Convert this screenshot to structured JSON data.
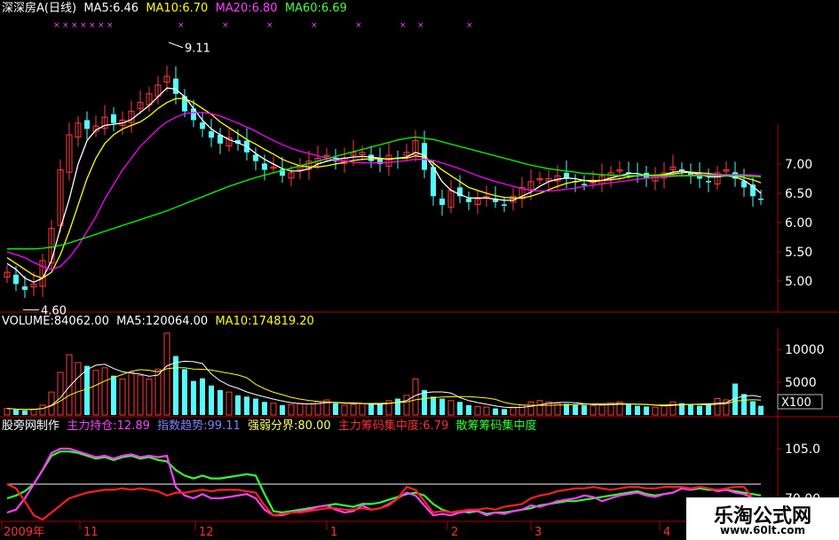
{
  "header_price": {
    "stock_name": "深深房A",
    "period": "(日线)",
    "ma5": "MA5:6.46",
    "ma10": "MA10:6.70",
    "ma20": "MA20:6.80",
    "ma60": "MA60:6.69"
  },
  "header_volume": {
    "volume": "VOLUME:84062.00",
    "ma5": "MA5:120064.00",
    "ma10": "MA10:174819.20"
  },
  "header_indicator": {
    "source": "股旁网制作",
    "main_holding": "主力持仓:12.89",
    "index_trend": "指数趋势:99.11",
    "strong_weak": "强弱分界:80.00",
    "main_chip": "主力筹码集中度:6.79",
    "retail_chip": "散筹筹码集中度"
  },
  "colors": {
    "up": "#ff3b3b",
    "down": "#54fcfc",
    "ma5": "#ffffff",
    "ma10": "#ffff00",
    "ma20": "#ff00ff",
    "ma60": "#00ff00",
    "axis": "#b00000",
    "indicator_red": "#ff2020",
    "indicator_pink": "#ff40ff",
    "indicator_green": "#30ff30",
    "indicator_line": "#c8c8c8"
  },
  "chart_data": [
    {
      "type": "line",
      "panel": "price",
      "note": "candlestick panel",
      "ylim": [
        4.5,
        9.5
      ],
      "yticks": [
        "7.00",
        "6.50",
        "6.00",
        "5.50",
        "5.00"
      ],
      "annotations": [
        "9.11",
        "4.60"
      ],
      "x": [
        0,
        10,
        20,
        30,
        40,
        50,
        60,
        70,
        80,
        90,
        100,
        110,
        120,
        130,
        140,
        150,
        160,
        170,
        180,
        190,
        200,
        210,
        220,
        230,
        240,
        250,
        260,
        270,
        280,
        290,
        300,
        310,
        320,
        330,
        340,
        350,
        360,
        370,
        380,
        390,
        400,
        410,
        420,
        430,
        440,
        450,
        460,
        470,
        480,
        490,
        500,
        510,
        520,
        530,
        540,
        550,
        560,
        570,
        580,
        590,
        600,
        610,
        620,
        630,
        640,
        650,
        660,
        670,
        680,
        690,
        700,
        710,
        720,
        730,
        740,
        750,
        760,
        770,
        780,
        790,
        800,
        810,
        820,
        830,
        840,
        849
      ],
      "close": [
        5.15,
        4.95,
        4.85,
        4.95,
        5.35,
        5.9,
        6.9,
        7.5,
        7.7,
        7.6,
        7.65,
        7.8,
        7.7,
        7.75,
        7.9,
        8.05,
        8.2,
        8.35,
        8.5,
        8.2,
        7.9,
        7.75,
        7.6,
        7.45,
        7.35,
        7.45,
        7.35,
        7.2,
        7.05,
        6.9,
        6.95,
        6.8,
        6.85,
        6.95,
        7.05,
        7.1,
        7.15,
        7.05,
        7.1,
        7.2,
        7.2,
        7.05,
        7.0,
        7.15,
        7.1,
        7.2,
        7.4,
        6.9,
        6.45,
        6.3,
        6.55,
        6.45,
        6.35,
        6.4,
        6.45,
        6.35,
        6.3,
        6.45,
        6.6,
        6.7,
        6.75,
        6.75,
        6.8,
        6.75,
        6.7,
        6.65,
        6.7,
        6.8,
        6.85,
        6.9,
        6.85,
        6.8,
        6.75,
        6.8,
        6.85,
        6.95,
        6.9,
        6.8,
        6.75,
        6.7,
        6.85,
        6.9,
        6.75,
        6.6,
        6.45,
        6.4
      ],
      "series": [
        {
          "name": "MA5",
          "values": [
            5.3,
            5.2,
            5.05,
            4.98,
            5.05,
            5.35,
            5.9,
            6.4,
            7.0,
            7.4,
            7.58,
            7.66,
            7.68,
            7.7,
            7.76,
            7.88,
            8.0,
            8.15,
            8.3,
            8.28,
            8.15,
            7.95,
            7.75,
            7.6,
            7.5,
            7.42,
            7.36,
            7.3,
            7.18,
            7.08,
            7.0,
            6.92,
            6.88,
            6.88,
            6.92,
            7.0,
            7.05,
            7.08,
            7.1,
            7.12,
            7.13,
            7.12,
            7.1,
            7.08,
            7.1,
            7.12,
            7.2,
            7.15,
            6.95,
            6.7,
            6.55,
            6.48,
            6.42,
            6.42,
            6.42,
            6.4,
            6.38,
            6.38,
            6.45,
            6.52,
            6.62,
            6.7,
            6.74,
            6.76,
            6.75,
            6.72,
            6.7,
            6.72,
            6.76,
            6.8,
            6.84,
            6.84,
            6.8,
            6.8,
            6.82,
            6.86,
            6.88,
            6.86,
            6.82,
            6.78,
            6.78,
            6.8,
            6.78,
            6.72,
            6.62,
            6.5
          ]
        },
        {
          "name": "MA10",
          "values": [
            5.4,
            5.3,
            5.2,
            5.1,
            5.05,
            5.15,
            5.45,
            5.85,
            6.3,
            6.75,
            7.1,
            7.35,
            7.5,
            7.6,
            7.66,
            7.72,
            7.82,
            7.95,
            8.05,
            8.12,
            8.12,
            8.05,
            7.95,
            7.85,
            7.72,
            7.62,
            7.52,
            7.42,
            7.34,
            7.25,
            7.17,
            7.08,
            7.02,
            6.97,
            6.95,
            6.95,
            6.97,
            7.0,
            7.03,
            7.06,
            7.08,
            7.09,
            7.09,
            7.09,
            7.1,
            7.1,
            7.14,
            7.12,
            7.02,
            6.9,
            6.8,
            6.7,
            6.6,
            6.55,
            6.5,
            6.46,
            6.43,
            6.42,
            6.42,
            6.45,
            6.5,
            6.56,
            6.62,
            6.67,
            6.7,
            6.72,
            6.72,
            6.72,
            6.73,
            6.75,
            6.78,
            6.8,
            6.81,
            6.81,
            6.82,
            6.83,
            6.85,
            6.86,
            6.85,
            6.84,
            6.82,
            6.81,
            6.8,
            6.77,
            6.73,
            6.68
          ]
        },
        {
          "name": "MA20",
          "values": [
            5.5,
            5.45,
            5.4,
            5.32,
            5.25,
            5.2,
            5.25,
            5.4,
            5.6,
            5.85,
            6.1,
            6.4,
            6.65,
            6.9,
            7.1,
            7.3,
            7.45,
            7.6,
            7.72,
            7.8,
            7.86,
            7.88,
            7.88,
            7.86,
            7.82,
            7.76,
            7.7,
            7.63,
            7.56,
            7.48,
            7.4,
            7.33,
            7.27,
            7.22,
            7.18,
            7.14,
            7.1,
            7.07,
            7.05,
            7.03,
            7.02,
            7.02,
            7.02,
            7.03,
            7.04,
            7.06,
            7.08,
            7.08,
            7.06,
            7.02,
            6.97,
            6.92,
            6.86,
            6.8,
            6.75,
            6.7,
            6.66,
            6.62,
            6.58,
            6.55,
            6.54,
            6.54,
            6.55,
            6.57,
            6.59,
            6.62,
            6.64,
            6.66,
            6.68,
            6.7,
            6.72,
            6.74,
            6.76,
            6.77,
            6.78,
            6.79,
            6.8,
            6.81,
            6.82,
            6.82,
            6.82,
            6.82,
            6.82,
            6.82,
            6.81,
            6.8
          ]
        },
        {
          "name": "MA60",
          "values": [
            5.55,
            5.55,
            5.55,
            5.55,
            5.56,
            5.58,
            5.61,
            5.65,
            5.7,
            5.75,
            5.8,
            5.85,
            5.9,
            5.95,
            6.0,
            6.05,
            6.1,
            6.15,
            6.2,
            6.26,
            6.32,
            6.38,
            6.44,
            6.5,
            6.56,
            6.62,
            6.67,
            6.72,
            6.77,
            6.81,
            6.85,
            6.89,
            6.93,
            6.97,
            7.01,
            7.05,
            7.09,
            7.13,
            7.17,
            7.21,
            7.25,
            7.29,
            7.33,
            7.37,
            7.41,
            7.44,
            7.46,
            7.44,
            7.42,
            7.38,
            7.34,
            7.3,
            7.26,
            7.22,
            7.18,
            7.14,
            7.1,
            7.06,
            7.02,
            6.98,
            6.95,
            6.92,
            6.9,
            6.88,
            6.86,
            6.84,
            6.83,
            6.82,
            6.81,
            6.8,
            6.8,
            6.8,
            6.8,
            6.8,
            6.8,
            6.8,
            6.8,
            6.8,
            6.8,
            6.8,
            6.8,
            6.8,
            6.8,
            6.8,
            6.79,
            6.78
          ]
        }
      ]
    },
    {
      "type": "bar",
      "panel": "volume",
      "ylim": [
        0,
        13000
      ],
      "yticks": [
        "10000",
        "5000"
      ],
      "unit_label": "X100",
      "values": [
        1000,
        800,
        700,
        900,
        1500,
        3500,
        6500,
        9200,
        8000,
        7500,
        6800,
        7200,
        6000,
        5500,
        6500,
        6000,
        5500,
        7000,
        12500,
        9000,
        7000,
        5200,
        5600,
        4500,
        3800,
        3500,
        3000,
        2800,
        2500,
        2000,
        1800,
        1500,
        1600,
        1800,
        1700,
        2000,
        2300,
        1800,
        1500,
        1600,
        1700,
        1600,
        1700,
        2200,
        2500,
        3000,
        5500,
        3800,
        2800,
        2500,
        2200,
        2000,
        1500,
        1300,
        1200,
        1000,
        900,
        1200,
        1500,
        2000,
        2200,
        2000,
        1800,
        1700,
        1600,
        1500,
        1400,
        1500,
        1800,
        2000,
        1600,
        1400,
        1300,
        1200,
        1500,
        2000,
        1800,
        1600,
        1400,
        1700,
        2500,
        2300,
        4800,
        3200,
        2100,
        1400
      ]
    },
    {
      "type": "line",
      "panel": "indicator",
      "ylim": [
        55,
        115
      ],
      "yticks": [
        "105.0",
        "70.00"
      ],
      "x_ticks": [
        "2009年",
        "11",
        "12",
        "1",
        "2",
        "3",
        "4"
      ],
      "series": [
        {
          "name": "主力持仓",
          "values": [
            60,
            62,
            70,
            80,
            90,
            102,
            105,
            105,
            103,
            101,
            99,
            100,
            98,
            100,
            101,
            99,
            100,
            99,
            100,
            78,
            72,
            70,
            73,
            70,
            70,
            71,
            72,
            73,
            70,
            62,
            58,
            58,
            60,
            61,
            62,
            64,
            65,
            62,
            60,
            61,
            65,
            62,
            63,
            66,
            70,
            74,
            72,
            65,
            58,
            59,
            58,
            60,
            61,
            61,
            58,
            60,
            59,
            61,
            62,
            65,
            64,
            66,
            68,
            69,
            70,
            72,
            71,
            68,
            70,
            72,
            73,
            74,
            72,
            71,
            73,
            74,
            77,
            76,
            78,
            77,
            75,
            76,
            74,
            73,
            70,
            68
          ]
        },
        {
          "name": "指数趋势",
          "values": [
            70,
            72,
            75,
            80,
            90,
            100,
            103,
            103,
            102,
            100,
            98,
            99,
            97,
            99,
            100,
            98,
            99,
            97,
            96,
            90,
            86,
            84,
            86,
            84,
            84,
            85,
            86,
            87,
            86,
            73,
            61,
            60,
            61,
            62,
            63,
            64,
            65,
            66,
            65,
            64,
            66,
            66,
            67,
            69,
            71,
            73,
            74,
            72,
            66,
            62,
            60,
            61,
            60,
            61,
            59,
            60,
            60,
            61,
            62,
            63,
            65,
            66,
            67,
            68,
            68,
            69,
            70,
            71,
            72,
            73,
            74,
            75,
            73,
            72,
            73,
            74,
            77,
            76,
            77,
            76,
            76,
            76,
            75,
            74,
            73,
            72
          ]
        },
        {
          "name": "强弱分界",
          "values": [
            80,
            80,
            80,
            80,
            80,
            80,
            80,
            80,
            80,
            80,
            80,
            80,
            80,
            80,
            80,
            80,
            80,
            80,
            80,
            80,
            80,
            80,
            80,
            80,
            80,
            80,
            80,
            80,
            80,
            80,
            80,
            80,
            80,
            80,
            80,
            80,
            80,
            80,
            80,
            80,
            80,
            80,
            80,
            80,
            80,
            80,
            80,
            80,
            80,
            80,
            80,
            80,
            80,
            80,
            80,
            80,
            80,
            80,
            80,
            80,
            80,
            80,
            80,
            80,
            80,
            80,
            80,
            80,
            80,
            80,
            80,
            80,
            80,
            80,
            80,
            80,
            80,
            80,
            80,
            80,
            80,
            80,
            80,
            80,
            80,
            80
          ]
        },
        {
          "name": "主力筹码集中度",
          "values": [
            80,
            77,
            68,
            58,
            55,
            60,
            65,
            70,
            72,
            74,
            75,
            76,
            76,
            77,
            76,
            77,
            76,
            75,
            72,
            74,
            74,
            75,
            76,
            75,
            76,
            76,
            76,
            75,
            74,
            65,
            58,
            59,
            60,
            60,
            61,
            62,
            63,
            63,
            62,
            62,
            63,
            62,
            63,
            65,
            70,
            78,
            76,
            68,
            60,
            61,
            60,
            61,
            62,
            62,
            63,
            62,
            64,
            65,
            66,
            70,
            72,
            73,
            75,
            76,
            77,
            77,
            78,
            77,
            76,
            77,
            78,
            78,
            77,
            77,
            78,
            78,
            78,
            77,
            78,
            77,
            76,
            77,
            78,
            78,
            70,
            65
          ]
        }
      ]
    }
  ]
}
